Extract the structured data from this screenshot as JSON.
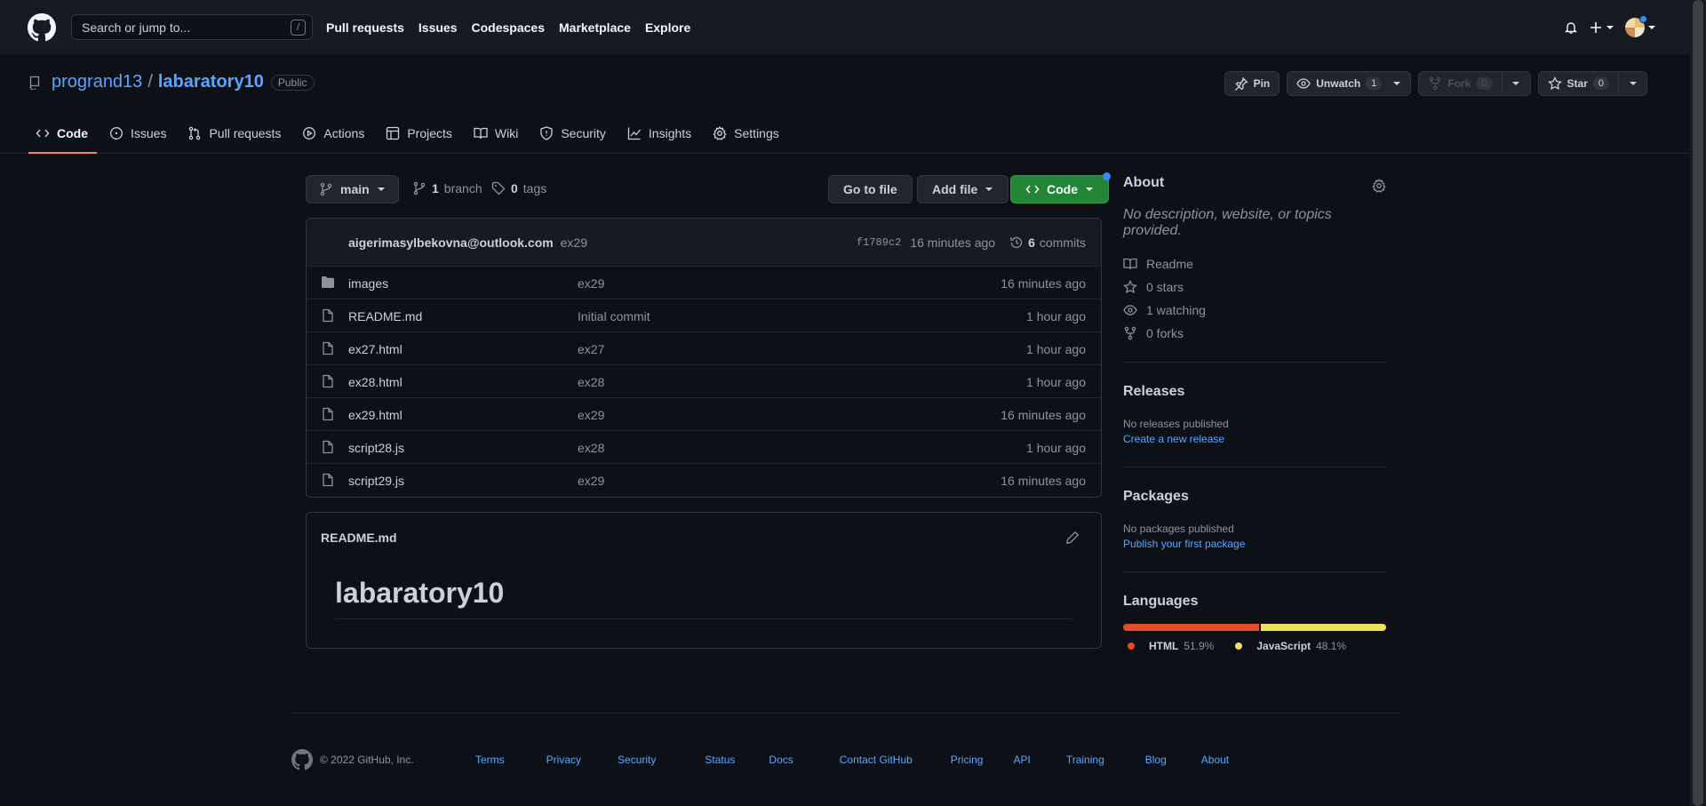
{
  "header": {
    "search_placeholder": "Search or jump to...",
    "search_shortcut": "/",
    "nav": [
      "Pull requests",
      "Issues",
      "Codespaces",
      "Marketplace",
      "Explore"
    ]
  },
  "repo": {
    "owner": "progrand13",
    "separator": "/",
    "name": "labaratory10",
    "visibility": "Public",
    "pin_label": "Pin",
    "unwatch_label": "Unwatch",
    "watch_count": "1",
    "fork_label": "Fork",
    "fork_count": "0",
    "star_label": "Star",
    "star_count": "0"
  },
  "tabs": [
    "Code",
    "Issues",
    "Pull requests",
    "Actions",
    "Projects",
    "Wiki",
    "Security",
    "Insights",
    "Settings"
  ],
  "branchbar": {
    "branch": "main",
    "branch_count": "1",
    "branch_label": "branch",
    "tag_count": "0",
    "tag_label": "tags",
    "goto_label": "Go to file",
    "addfile_label": "Add file",
    "code_label": "Code"
  },
  "commit": {
    "author": "aigerimasylbekovna@outlook.com",
    "message": "ex29",
    "sha": "f1789c2",
    "age": "16 minutes ago",
    "count": "6",
    "count_label": "commits"
  },
  "files": [
    {
      "name": "images",
      "type": "folder",
      "message": "ex29",
      "age": "16 minutes ago"
    },
    {
      "name": "README.md",
      "type": "file",
      "message": "Initial commit",
      "age": "1 hour ago"
    },
    {
      "name": "ex27.html",
      "type": "file",
      "message": "ex27",
      "age": "1 hour ago"
    },
    {
      "name": "ex28.html",
      "type": "file",
      "message": "ex28",
      "age": "1 hour ago"
    },
    {
      "name": "ex29.html",
      "type": "file",
      "message": "ex29",
      "age": "16 minutes ago"
    },
    {
      "name": "script28.js",
      "type": "file",
      "message": "ex28",
      "age": "1 hour ago"
    },
    {
      "name": "script29.js",
      "type": "file",
      "message": "ex29",
      "age": "16 minutes ago"
    }
  ],
  "readme": {
    "filename": "README.md",
    "heading": "labaratory10"
  },
  "about": {
    "title": "About",
    "description": "No description, website, or topics provided.",
    "readme": "Readme",
    "stars": "0 stars",
    "watching": "1 watching",
    "forks": "0 forks"
  },
  "releases": {
    "title": "Releases",
    "empty": "No releases published",
    "link": "Create a new release"
  },
  "packages": {
    "title": "Packages",
    "empty": "No packages published",
    "link": "Publish your first package"
  },
  "languages": {
    "title": "Languages",
    "items": [
      {
        "name": "HTML",
        "percent": "51.9%",
        "value": 51.9,
        "color": "#e34c26"
      },
      {
        "name": "JavaScript",
        "percent": "48.1%",
        "value": 48.1,
        "color": "#f1e05a"
      }
    ]
  },
  "footer": {
    "copyright": "© 2022 GitHub, Inc.",
    "links": [
      "Terms",
      "Privacy",
      "Security",
      "Status",
      "Docs",
      "Contact GitHub",
      "Pricing",
      "API",
      "Training",
      "Blog",
      "About"
    ]
  },
  "colors": {
    "accent": "#58a6ff",
    "tab_underline": "#f78166",
    "code_button": "#238636",
    "background": "#0d1117"
  }
}
